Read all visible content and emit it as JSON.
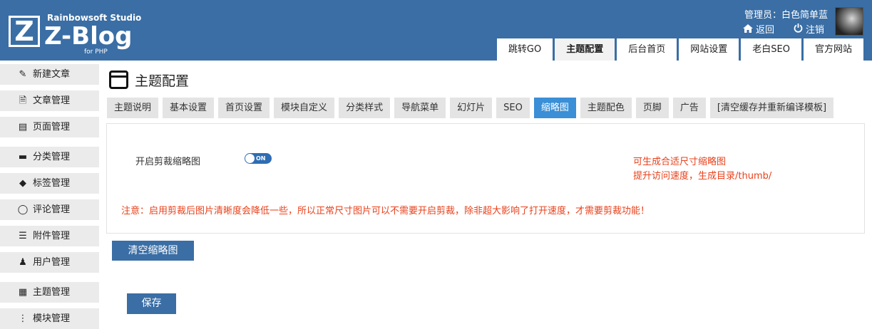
{
  "brand": {
    "studio": "Rainbowsoft Studio",
    "name": "Z-Blog",
    "platform": "for PHP",
    "mark": "Z"
  },
  "header": {
    "admin_label": "管理员：白色简单蓝",
    "back_label": "返回",
    "logout_label": "注销",
    "nav": [
      "跳转GO",
      "主题配置",
      "后台首页",
      "网站设置",
      "老白SEO",
      "官方网站"
    ],
    "active_nav": "主题配置"
  },
  "sidebar": {
    "items": [
      {
        "label": "新建文章",
        "icon": "edit-icon"
      },
      {
        "label": "文章管理",
        "icon": "document-icon"
      },
      {
        "label": "页面管理",
        "icon": "page-icon"
      },
      {
        "label": "分类管理",
        "icon": "folder-icon"
      },
      {
        "label": "标签管理",
        "icon": "tag-icon"
      },
      {
        "label": "评论管理",
        "icon": "comment-icon"
      },
      {
        "label": "附件管理",
        "icon": "attachment-icon"
      },
      {
        "label": "用户管理",
        "icon": "user-icon"
      },
      {
        "label": "主题管理",
        "icon": "theme-icon"
      },
      {
        "label": "模块管理",
        "icon": "module-icon"
      }
    ]
  },
  "main": {
    "title": "主题配置",
    "tabs": [
      "主题说明",
      "基本设置",
      "首页设置",
      "模块自定义",
      "分类样式",
      "导航菜单",
      "幻灯片",
      "SEO",
      "缩略图",
      "主题配色",
      "页脚",
      "广告",
      "[清空缓存并重新编译模板]"
    ],
    "active_tab": "缩略图",
    "option": {
      "label": "开启剪裁缩略图",
      "toggle_text": "ON",
      "enabled": true,
      "hint_lines": [
        "可生成合适尺寸缩略图",
        "提升访问速度，生成目录/thumb/"
      ]
    },
    "notice": "注意：启用剪裁后图片清晰度会降低一些，所以正常尺寸图片可以不需要开启剪裁，除非超大影响了打开速度，才需要剪裁功能！",
    "clear_button": "清空缩略图",
    "save_button": "保存"
  },
  "colors": {
    "header_bg": "#3a6ea5",
    "active_tab": "#3a8fd6",
    "warning_text": "#e8411b",
    "toggle_on": "#2e6db3"
  }
}
